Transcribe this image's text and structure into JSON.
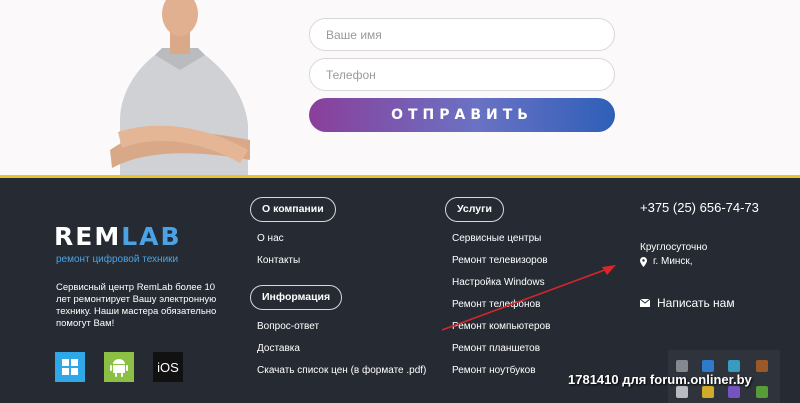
{
  "form": {
    "name_placeholder": "Ваше имя",
    "phone_placeholder": "Телефон",
    "submit_label": "ОТПРАВИТЬ"
  },
  "brand": {
    "logo_part1": "REM",
    "logo_part2": "LAB",
    "tagline": "ремонт цифровой техники",
    "about": "Сервисный центр RemLab более 10 лет ремонтирует Вашу электронную технику. Наши мастера обязательно помогут Вам!",
    "ios_label": "iOS"
  },
  "company": {
    "heading": "О компании",
    "links": [
      "О нас",
      "Контакты"
    ]
  },
  "info": {
    "heading": "Информация",
    "links": [
      "Вопрос-ответ",
      "Доставка",
      "Скачать список цен (в формате .pdf)"
    ]
  },
  "services": {
    "heading": "Услуги",
    "links": [
      "Сервисные центры",
      "Ремонт телевизоров",
      "Настройка Windows",
      "Ремонт телефонов",
      "Ремонт компьютеров",
      "Ремонт планшетов",
      "Ремонт ноутбуков"
    ]
  },
  "contacts": {
    "phone": "+375 (25) 656-74-73",
    "hours": "Круглосуточно",
    "city": "г. Минск,",
    "write_label": "Написать нам"
  },
  "watermark": "1781410 для forum.onliner.by",
  "colors": {
    "footer_bg": "#262b33",
    "accent_yellow": "#e7c52a",
    "brand_blue": "#4ba3e6",
    "button_gradient_start": "#8a3f9a",
    "button_gradient_end": "#2e5fb8",
    "arrow_red": "#d9262a"
  }
}
